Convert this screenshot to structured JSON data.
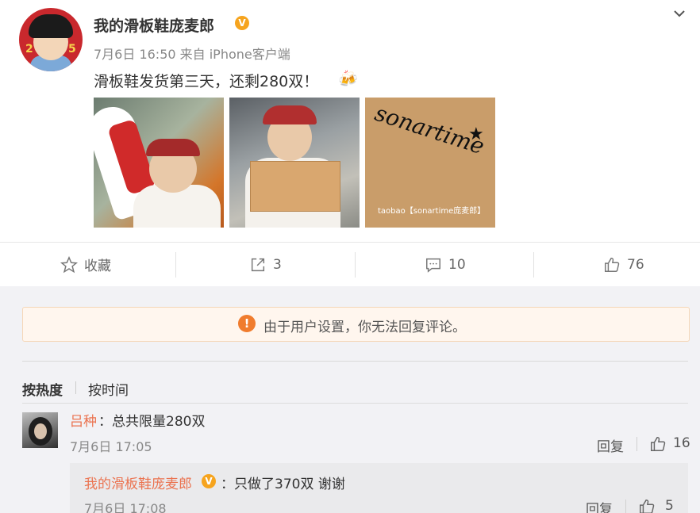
{
  "post": {
    "author": "我的滑板鞋庞麦郎",
    "verified_badge": "V",
    "meta": "7月6日 16:50 来自 iPhone客户端",
    "text": "滑板鞋发货第三天，还剩280双！",
    "emoji": "🍻",
    "avatar_numbers": [
      "2",
      "5"
    ],
    "images": [
      {
        "name": "photo-shoe-selfie"
      },
      {
        "name": "photo-box-holding"
      },
      {
        "name": "photo-box-logo",
        "logo_text": "sonartime",
        "watermark": "taobao【sonartime庞麦郎】"
      }
    ]
  },
  "actions": {
    "favorite_label": "收藏",
    "repost_count": "3",
    "comment_count": "10",
    "like_count": "76"
  },
  "notice": {
    "icon": "!",
    "text": "由于用户设置，你无法回复评论。"
  },
  "sort": {
    "hot": "按热度",
    "time": "按时间"
  },
  "comments": [
    {
      "user": "吕种",
      "text": "：总共限量280双",
      "time": "7月6日 17:05",
      "reply_label": "回复",
      "likes": "16",
      "replies": [
        {
          "user": "我的滑板鞋庞麦郎",
          "badge": "V",
          "text": "：只做了370双 谢谢",
          "time": "7月6日 17:08",
          "reply_label": "回复",
          "likes": "5"
        }
      ]
    }
  ],
  "colors": {
    "username": "#eb7350",
    "badge": "#f6a41e",
    "notice_icon": "#f07c2e",
    "notice_bg": "#fff6ee"
  }
}
